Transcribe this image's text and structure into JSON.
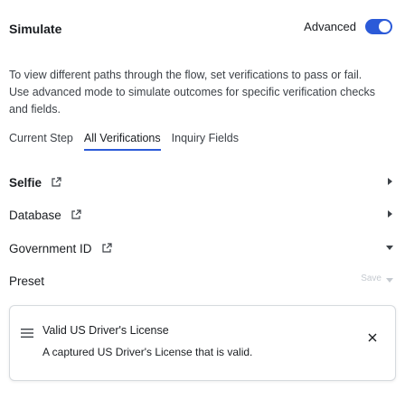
{
  "header": {
    "title": "Simulate",
    "advanced_label": "Advanced",
    "advanced_on": true
  },
  "description": "To view different paths through the flow, set verifications to pass or fail. Use advanced mode to simulate outcomes for specific verification checks and fields.",
  "tabs": [
    {
      "label": "Current Step",
      "active": false
    },
    {
      "label": "All Verifications",
      "active": true
    },
    {
      "label": "Inquiry Fields",
      "active": false
    }
  ],
  "rows": [
    {
      "label": "Selfie",
      "icon": "external-link-icon",
      "caret": "caret-right"
    },
    {
      "label": "Database",
      "icon": "external-link-icon",
      "caret": "caret-right"
    },
    {
      "label": "Government ID",
      "icon": "external-link-icon",
      "caret": "caret-down"
    }
  ],
  "preset": {
    "label": "Preset",
    "save_label": "Save"
  },
  "dropdown_card": {
    "title": "Valid US Driver's License",
    "subtitle": "A captured US Driver's License that is valid."
  },
  "colors": {
    "accent": "#2b5ad8",
    "text": "#1a1d21",
    "muted": "#3d4248"
  }
}
